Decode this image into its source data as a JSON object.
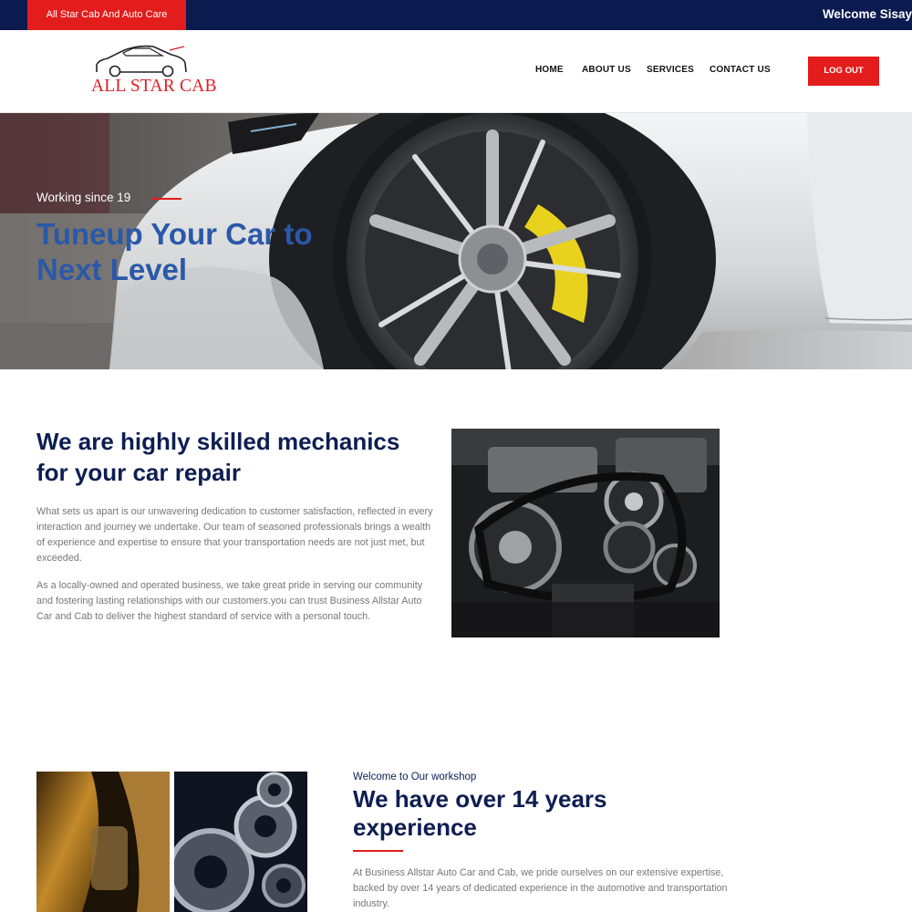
{
  "topbar": {
    "brand": "All Star Cab And Auto Care",
    "welcome": "Welcome Sisay"
  },
  "header": {
    "logo_text": "ALL STAR CAB",
    "logo_icon": "car-outline-icon",
    "nav": [
      "HOME",
      "ABOUT US",
      "SERVICES",
      "CONTACT US"
    ],
    "logout_label": "LOG OUT"
  },
  "hero": {
    "kicker": "Working since 19",
    "title": "Tuneup Your Car to Next Level"
  },
  "about": {
    "title": "We are highly skilled mechanics for your car repair",
    "paragraphs": [
      "What sets us apart is our unwavering dedication to customer satisfaction, reflected in every interaction and journey we undertake. Our team of seasoned professionals brings a wealth of experience and expertise to ensure that your transportation needs are not just met, but exceeded.",
      "As a locally-owned and operated business, we take great pride in serving our community and fostering lasting relationships with our customers.you can trust Business Allstar Auto Car and Cab to deliver the highest standard of service with a personal touch."
    ]
  },
  "workshop": {
    "kicker": "Welcome to Our workshop",
    "title": "We have over 14 years experience",
    "paragraph": "At Business Allstar Auto Car and Cab, we pride ourselves on our extensive expertise, backed by over 14 years of dedicated experience in the automotive and transportation industry."
  },
  "colors": {
    "navy": "#0b1a4f",
    "accent_red": "#e31c1c",
    "hero_title_blue": "#2b58a8",
    "heading_navy": "#0e1e52"
  }
}
